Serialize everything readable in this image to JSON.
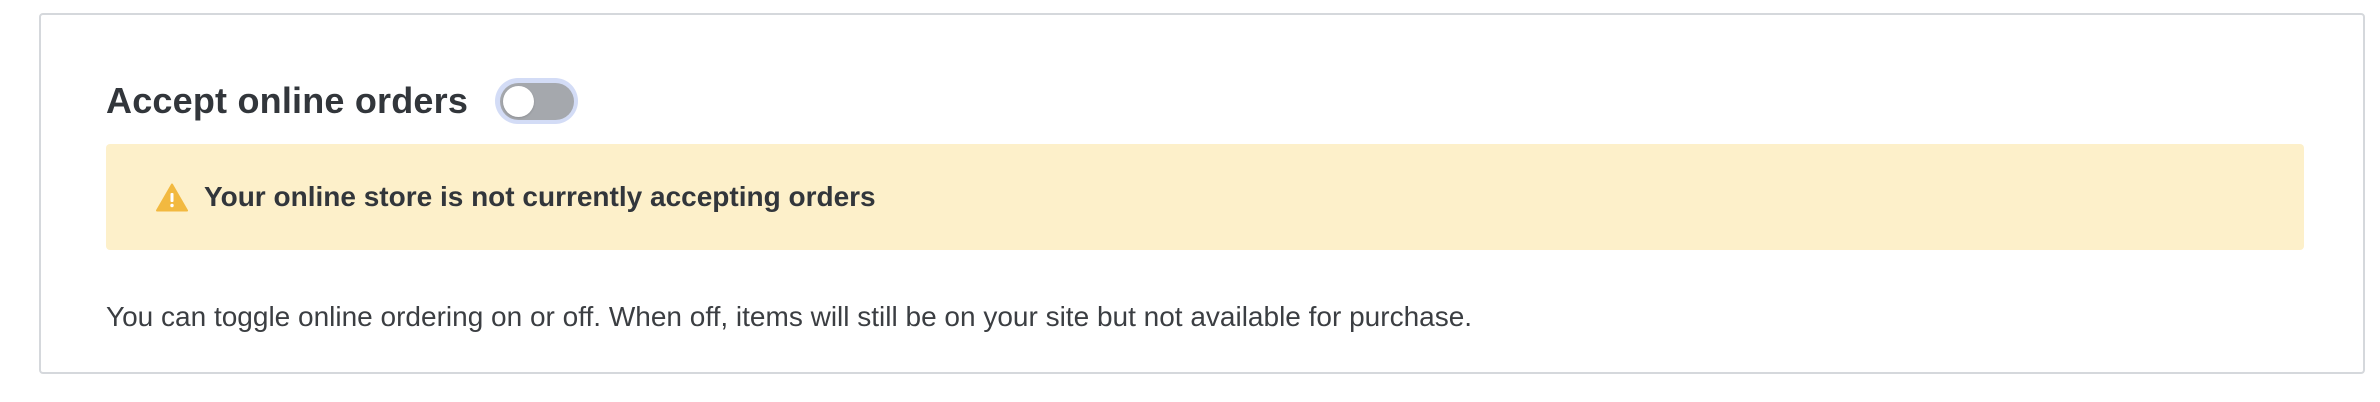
{
  "settings": {
    "title": "Accept online orders",
    "toggle": {
      "state": "off"
    },
    "alert": {
      "icon": "warning-icon",
      "icon_color": "#f2b940",
      "background": "#fdf0ca",
      "message": "Your online store is not currently accepting orders"
    },
    "description": "You can toggle online ordering on or off. When off, items will still be on your site but not available for purchase."
  }
}
